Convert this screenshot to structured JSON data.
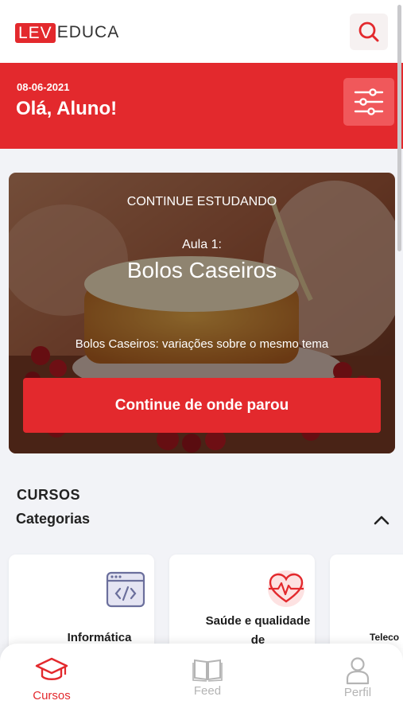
{
  "header": {
    "logo_highlight": "LEV",
    "logo_rest": "EDUCA",
    "search_icon": "search-icon"
  },
  "banner": {
    "date": "08-06-2021",
    "greeting": "Olá, Aluno!",
    "filter_icon": "sliders-icon"
  },
  "continue_card": {
    "label": "CONTINUE ESTUDANDO",
    "lesson": "Aula 1:",
    "title": "Bolos Caseiros",
    "subtitle": "Bolos Caseiros: variações sobre o mesmo tema",
    "button_label": "Continue de onde parou"
  },
  "courses": {
    "section_title": "CURSOS",
    "subtitle": "Categorias",
    "toggle_icon": "chevron-up-icon",
    "categories": [
      {
        "label": "Informática",
        "icon": "code-window-icon"
      },
      {
        "label": "Saúde e qualidade de",
        "icon": "heartbeat-icon"
      },
      {
        "label": "Teleco",
        "icon": ""
      }
    ]
  },
  "bottom_nav": {
    "items": [
      {
        "label": "Cursos",
        "icon": "graduation-cap-icon",
        "active": true
      },
      {
        "label": "Feed",
        "icon": "book-icon",
        "active": false
      },
      {
        "label": "Perfil",
        "icon": "user-icon",
        "active": false
      }
    ]
  },
  "colors": {
    "brand_red": "#e3292d",
    "background": "#f2f3f7",
    "inactive_nav": "#b4b4b4"
  }
}
